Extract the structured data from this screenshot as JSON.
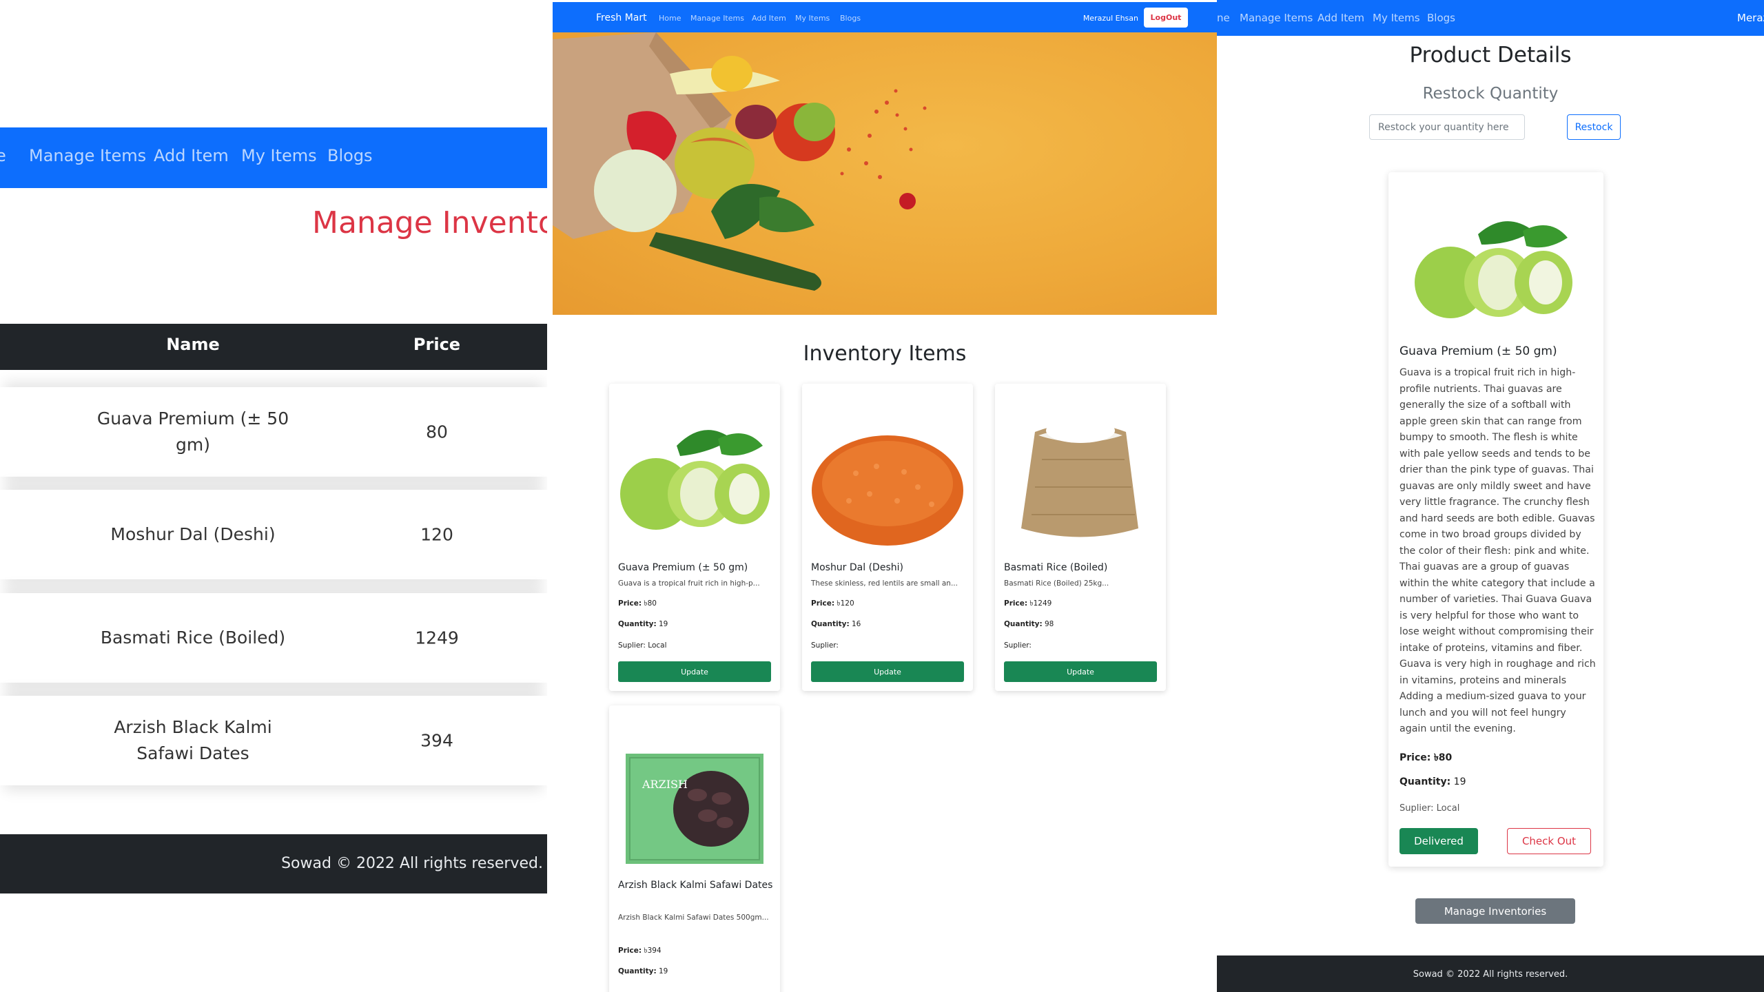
{
  "left": {
    "nav": {
      "home_partial": "e",
      "manage_items": "Manage Items",
      "add_item": "Add Item",
      "my_items": "My Items",
      "blogs": "Blogs"
    },
    "title": "Manage Inventor",
    "table": {
      "headers": [
        "Name",
        "Price"
      ],
      "rows": [
        {
          "name": "Guava Premium (± 50 gm)",
          "price": "80"
        },
        {
          "name": "Moshur Dal (Deshi)",
          "price": "120"
        },
        {
          "name": "Basmati Rice (Boiled)",
          "price": "1249"
        },
        {
          "name": "Arzish Black Kalmi Safawi Dates",
          "price": "394"
        }
      ]
    },
    "footer": "Sowad © 2022 All rights reserved."
  },
  "mid": {
    "nav": {
      "brand": "Fresh Mart",
      "home": "Home",
      "manage_items": "Manage Items",
      "add_item": "Add Item",
      "my_items": "My Items",
      "blogs": "Blogs",
      "user": "Merazul Ehsan",
      "logout": "LogOut"
    },
    "section_title": "Inventory Items",
    "labels": {
      "price": "Price:",
      "quantity": "Quantity:",
      "supplier": "Suplier:",
      "update": "Update"
    },
    "products": [
      {
        "name": "Guava Premium (± 50 gm)",
        "desc": "Guava is a tropical fruit rich in high-p...",
        "price": "৳80",
        "quantity": "19",
        "supplier": "Local",
        "image": "guava"
      },
      {
        "name": "Moshur Dal (Deshi)",
        "desc": "These skinless, red lentils are small an...",
        "price": "৳120",
        "quantity": "16",
        "supplier": "",
        "image": "lentils"
      },
      {
        "name": "Basmati Rice (Boiled)",
        "desc": "Basmati Rice (Boiled) 25kg...",
        "price": "৳1249",
        "quantity": "98",
        "supplier": "",
        "image": "rice-sack"
      },
      {
        "name": "Arzish Black Kalmi Safawi Dates",
        "desc": "Arzish Black Kalmi Safawi Dates 500gm...",
        "price": "৳394",
        "quantity": "19",
        "supplier": "",
        "image": "dates-box"
      }
    ]
  },
  "right": {
    "nav": {
      "home_partial": "ne",
      "manage_items": "Manage Items",
      "add_item": "Add Item",
      "my_items": "My Items",
      "blogs": "Blogs",
      "user_partial": "Meraz"
    },
    "title": "Product Details",
    "subtitle": "Restock Quantity",
    "restock": {
      "placeholder": "Restock your quantity here",
      "button": "Restock"
    },
    "product": {
      "name": "Guava Premium (± 50 gm)",
      "desc": "Guava is a tropical fruit rich in high-profile nutrients. Thai guavas are generally the size of a softball with apple green skin that can range from bumpy to smooth. The flesh is white with pale yellow seeds and tends to be drier than the pink type of guavas. Thai guavas are only mildly sweet and have very little fragrance. The crunchy flesh and hard seeds are both edible. Guavas come in two broad groups divided by the color of their flesh: pink and white. Thai guavas are a group of guavas within the white category that include a number of varieties. Thai Guava Guava is very helpful for those who want to lose weight without compromising their intake of proteins, vitamins and fiber. Guava is very high in roughage and rich in vitamins, proteins and minerals Adding a medium-sized guava to your lunch and you will not feel hungry again until the evening.",
      "price_label": "Price:",
      "price": "৳80",
      "quantity_label": "Quantity:",
      "quantity": "19",
      "supplier_label": "Suplier:",
      "supplier": "Local"
    },
    "buttons": {
      "delivered": "Delivered",
      "checkout": "Check Out",
      "manage": "Manage Inventories"
    },
    "footer": "Sowad © 2022 All rights reserved."
  },
  "colors": {
    "primary": "#0d6efd",
    "danger": "#dc3545",
    "success": "#198754",
    "secondary": "#6c757d",
    "dark": "#212529"
  }
}
